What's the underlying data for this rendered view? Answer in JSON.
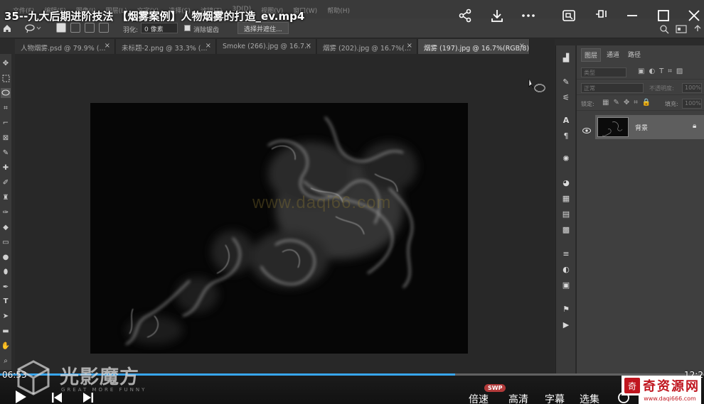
{
  "player": {
    "title": "35--九大后期进阶技法 【烟雾案例】人物烟雾的打造_ev.mp4",
    "current_time": "06:53",
    "total_time": "12:2",
    "progress": 0.646,
    "speed_label": "倍速",
    "quality_label": "高清",
    "subtitle_label": "字幕",
    "episodes_label": "选集",
    "swp_badge": "SWP",
    "share_icon": "share-icon",
    "download_icon": "download-icon",
    "more_icon": "more-icon",
    "pip_icon": "pip-icon",
    "pin_icon": "pin-icon",
    "minimize_icon": "minimize-icon",
    "maximize_icon": "maximize-icon",
    "close_icon": "close-icon"
  },
  "photoshop": {
    "menu": [
      "文件(F)",
      "编辑(E)",
      "图像(I)",
      "图层(L)",
      "文字(Y)",
      "选择(S)",
      "滤镜(T)",
      "3D(D)",
      "视图(V)",
      "窗口(W)",
      "帮助(H)"
    ],
    "options": {
      "feather_label": "羽化:",
      "feather_value": "0 像素",
      "antialias_label": "消除锯齿",
      "select_mask_label": "选择并遮住..."
    },
    "tabs": [
      {
        "label": "人物烟雾.psd @ 79.9% (...",
        "active": false
      },
      {
        "label": "未标题-2.png @ 33.3% (...",
        "active": false
      },
      {
        "label": "Smoke (266).jpg @ 16.7...",
        "active": false
      },
      {
        "label": "烟雾 (202).jpg @ 16.7%(...",
        "active": false
      },
      {
        "label": "烟雾 (197).jpg @ 16.7%(RGB/8)",
        "active": true
      }
    ],
    "canvas_watermark": "www.daqi66.com",
    "layers_panel": {
      "tabs": [
        "图层",
        "通道",
        "路径"
      ],
      "kind_placeholder": "类型",
      "blend_mode": "正常",
      "opacity_label": "不透明度:",
      "opacity_value": "100%",
      "lock_label": "锁定:",
      "fill_label": "填充:",
      "fill_value": "100%",
      "layer_name": "背景"
    }
  },
  "branding": {
    "logo_text": "光影魔方",
    "logo_sub": "GREAT MORE FUNNY",
    "site_name": "奇资源网",
    "site_url": "www.daqi666.com"
  }
}
